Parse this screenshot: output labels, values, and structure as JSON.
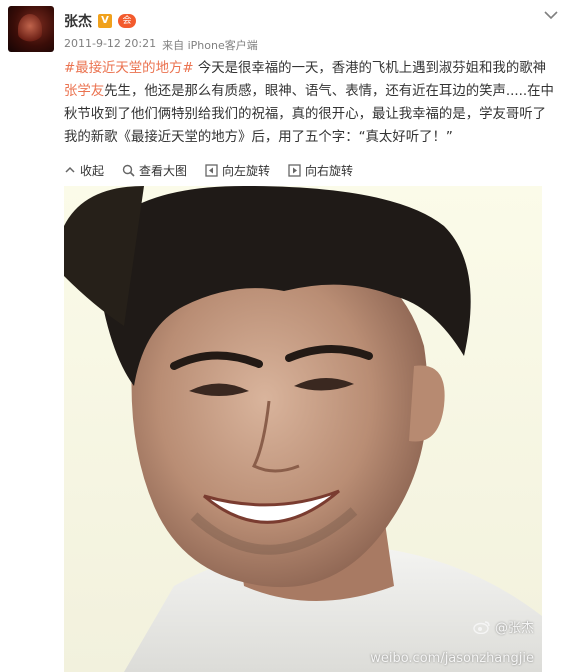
{
  "post": {
    "user_name": "张杰",
    "verified_badge": "V",
    "member_badge": "会",
    "timestamp": "2011-9-12 20:21",
    "source": "来自 iPhone客户端",
    "hashtag": "#最接近天堂的地方#",
    "text_part1": " 今天是很幸福的一天，香港的飞机上遇到淑芬姐和我的歌神",
    "mention": "张学友",
    "text_part2": "先生，他还是那么有质感，眼神、语气、表情，还有近在耳边的笑声.....在中秋节收到了他们俩特别给我们的祝福，真的很开心，最让我幸福的是，学友哥听了我的新歌《最接近天堂的地方》后，用了五个字：“真太好听了！”"
  },
  "actions": [
    {
      "label": "收起",
      "icon": "collapse-icon"
    },
    {
      "label": "查看大图",
      "icon": "zoom-icon"
    },
    {
      "label": "向左旋转",
      "icon": "rotate-left-icon"
    },
    {
      "label": "向右旋转",
      "icon": "rotate-right-icon"
    }
  ],
  "photo": {
    "watermark_name": "@张杰",
    "watermark_url": "weibo.com/jasonzhangjie"
  },
  "colors": {
    "accent": "#eb7350",
    "text": "#333333",
    "muted": "#808080"
  }
}
